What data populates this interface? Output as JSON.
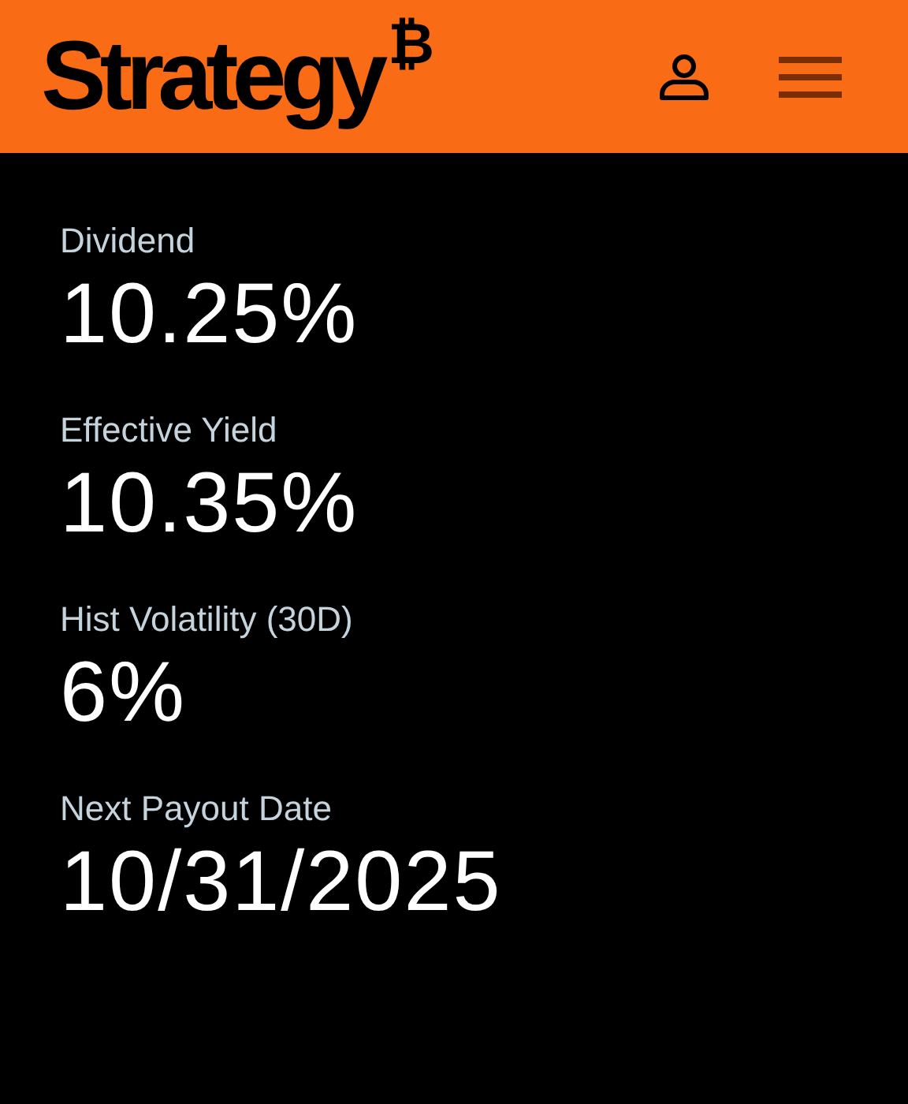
{
  "header": {
    "logo": {
      "name": "Strategy",
      "symbol": "₿"
    }
  },
  "stats": [
    {
      "label": "Dividend",
      "value": "10.25%"
    },
    {
      "label": "Effective Yield",
      "value": "10.35%"
    },
    {
      "label": "Hist Volatility (30D)",
      "value": "6%"
    },
    {
      "label": "Next Payout Date",
      "value": "10/31/2025"
    }
  ]
}
